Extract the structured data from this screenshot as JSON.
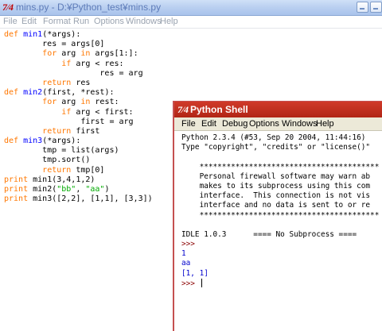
{
  "editor": {
    "title": "mins.py - D:¥Python_test¥mins.py",
    "icon_glyph": "7⁄4",
    "menu": [
      "File",
      "Edit",
      "Format",
      "Run",
      "Options",
      "Windows",
      "Help"
    ],
    "code_lines": [
      [
        {
          "t": "def ",
          "c": "kw"
        },
        {
          "t": "min1",
          "c": "fn"
        },
        {
          "t": "(*args):"
        }
      ],
      [
        {
          "t": "        res = args[0]"
        }
      ],
      [
        {
          "t": "        "
        },
        {
          "t": "for",
          "c": "kw"
        },
        {
          "t": " arg "
        },
        {
          "t": "in",
          "c": "kw"
        },
        {
          "t": " args[1:]:"
        }
      ],
      [
        {
          "t": "            "
        },
        {
          "t": "if",
          "c": "kw"
        },
        {
          "t": " arg < res:"
        }
      ],
      [
        {
          "t": "                    res = arg"
        }
      ],
      [
        {
          "t": "        "
        },
        {
          "t": "return",
          "c": "kw"
        },
        {
          "t": " res"
        }
      ],
      [
        {
          "t": "def ",
          "c": "kw"
        },
        {
          "t": "min2",
          "c": "fn"
        },
        {
          "t": "(first, *rest):"
        }
      ],
      [
        {
          "t": "        "
        },
        {
          "t": "for",
          "c": "kw"
        },
        {
          "t": " arg "
        },
        {
          "t": "in",
          "c": "kw"
        },
        {
          "t": " rest:"
        }
      ],
      [
        {
          "t": "            "
        },
        {
          "t": "if",
          "c": "kw"
        },
        {
          "t": " arg < first:"
        }
      ],
      [
        {
          "t": "                first = arg"
        }
      ],
      [
        {
          "t": "        "
        },
        {
          "t": "return",
          "c": "kw"
        },
        {
          "t": " first"
        }
      ],
      [
        {
          "t": "def ",
          "c": "kw"
        },
        {
          "t": "min3",
          "c": "fn"
        },
        {
          "t": "(*args):"
        }
      ],
      [
        {
          "t": "        tmp = list(args)"
        }
      ],
      [
        {
          "t": "        tmp.sort()"
        }
      ],
      [
        {
          "t": "        "
        },
        {
          "t": "return",
          "c": "kw"
        },
        {
          "t": " tmp[0]"
        }
      ],
      [
        {
          "t": "print",
          "c": "kw"
        },
        {
          "t": " min1(3,4,1,2)"
        }
      ],
      [
        {
          "t": "print",
          "c": "kw"
        },
        {
          "t": " min2("
        },
        {
          "t": "\"bb\"",
          "c": "str"
        },
        {
          "t": ", "
        },
        {
          "t": "\"aa\"",
          "c": "str"
        },
        {
          "t": ")"
        }
      ],
      [
        {
          "t": "print",
          "c": "kw"
        },
        {
          "t": " min3([2,2], [1,1], [3,3])"
        }
      ]
    ]
  },
  "shell": {
    "title": "Python Shell",
    "icon_glyph": "7⁄4",
    "menu": [
      "File",
      "Edit",
      "Debug",
      "Options",
      "Windows",
      "Help"
    ],
    "lines": [
      [
        {
          "t": "Python 2.3.4 (#53, Sep 20 2004, 11:44:16)"
        }
      ],
      [
        {
          "t": "Type \"copyright\", \"credits\" or \"license()\""
        }
      ],
      [
        {
          "t": ""
        }
      ],
      [
        {
          "t": "    ****************************************"
        }
      ],
      [
        {
          "t": "    Personal firewall software may warn ab"
        }
      ],
      [
        {
          "t": "    makes to its subprocess using this com"
        }
      ],
      [
        {
          "t": "    interface.  This connection is not vis"
        }
      ],
      [
        {
          "t": "    interface and no data is sent to or re"
        }
      ],
      [
        {
          "t": "    ****************************************"
        }
      ],
      [
        {
          "t": ""
        }
      ],
      [
        {
          "t": "IDLE 1.0.3      ==== No Subprocess ===="
        }
      ],
      [
        {
          "t": ">>>",
          "c": "prompt"
        }
      ],
      [
        {
          "t": "1",
          "c": "out"
        }
      ],
      [
        {
          "t": "aa",
          "c": "out"
        }
      ],
      [
        {
          "t": "[1, 1]",
          "c": "out"
        }
      ],
      [
        {
          "t": ">>>",
          "c": "prompt"
        },
        {
          "t": " "
        }
      ]
    ]
  },
  "colors": {
    "keyword": "#ff7700",
    "function_name": "#0000ff",
    "string": "#00aa00",
    "prompt": "#8b0000",
    "output": "#0000cc",
    "editor_titlebar": "#b9cff0",
    "shell_titlebar": "#c62f20"
  }
}
